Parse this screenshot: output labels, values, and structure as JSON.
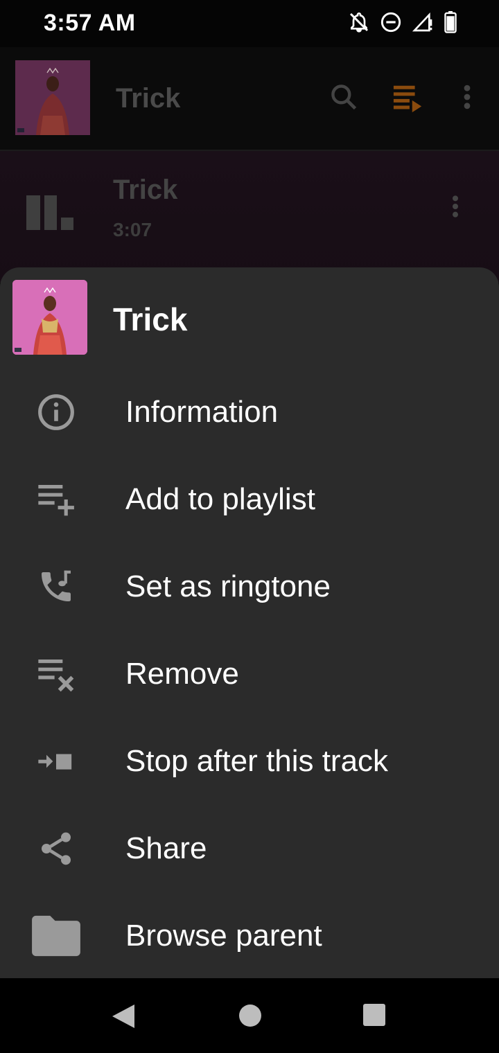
{
  "status_bar": {
    "time": "3:57 AM",
    "icons": [
      "bell-off-icon",
      "do-not-disturb-icon",
      "signal-icon",
      "battery-icon"
    ]
  },
  "toolbar": {
    "title": "Trick",
    "icons": [
      "search-icon",
      "queue-icon",
      "more-vert-icon"
    ],
    "accent_color": "#8a4b0e"
  },
  "now_playing": {
    "title": "Trick",
    "duration": "3:07"
  },
  "sheet": {
    "title": "Trick",
    "items": [
      {
        "label": "Information",
        "icon": "info-icon"
      },
      {
        "label": "Add to playlist",
        "icon": "playlist-add-icon"
      },
      {
        "label": "Set as ringtone",
        "icon": "ringtone-icon"
      },
      {
        "label": "Remove",
        "icon": "playlist-remove-icon"
      },
      {
        "label": "Stop after this track",
        "icon": "stop-after-icon"
      },
      {
        "label": "Share",
        "icon": "share-icon"
      },
      {
        "label": "Browse parent",
        "icon": "folder-icon"
      }
    ]
  },
  "nav_bar": {
    "buttons": [
      "back-icon",
      "home-icon",
      "recents-icon"
    ]
  }
}
